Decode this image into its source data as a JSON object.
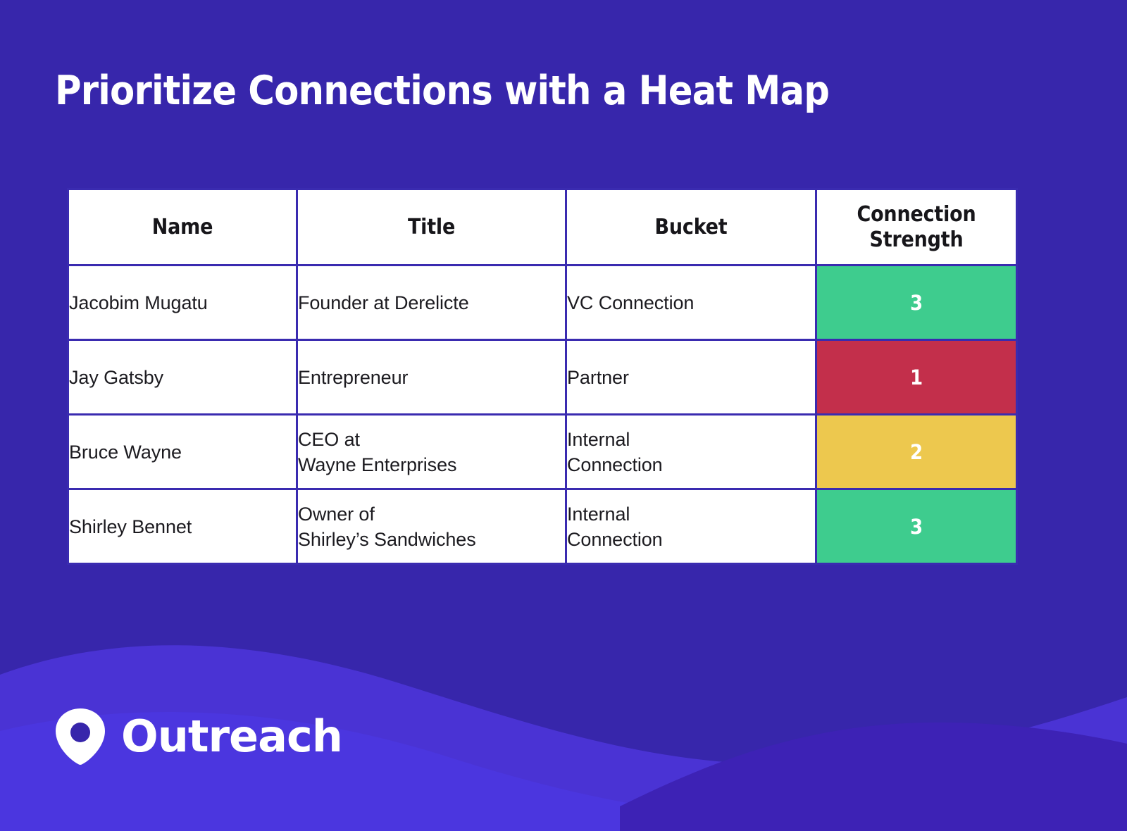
{
  "slide": {
    "title": "Prioritize Connections with a Heat Map",
    "background_color": "#3726ab",
    "wave_colors": [
      "#4a33d4",
      "#4b36df",
      "#3d22b5"
    ]
  },
  "table": {
    "columns": [
      {
        "key": "name",
        "label": "Name"
      },
      {
        "key": "title",
        "label": "Title"
      },
      {
        "key": "bucket",
        "label": "Bucket"
      },
      {
        "key": "strength",
        "label": "Connection\nStrength",
        "label_line1": "Connection",
        "label_line2": "Strength"
      }
    ],
    "border_color": "#3a2bb0",
    "rows": [
      {
        "name": "Jacobim Mugatu",
        "title_line1": "Founder at Derelicte",
        "title_line2": "",
        "bucket_line1": "VC Connection",
        "bucket_line2": "",
        "strength": "3",
        "strength_color": "#3ecc8e"
      },
      {
        "name": "Jay Gatsby",
        "title_line1": "Entrepreneur",
        "title_line2": "",
        "bucket_line1": "Partner",
        "bucket_line2": "",
        "strength": "1",
        "strength_color": "#c32f4b"
      },
      {
        "name": "Bruce Wayne",
        "title_line1": "CEO at",
        "title_line2": "Wayne Enterprises",
        "bucket_line1": "Internal",
        "bucket_line2": "Connection",
        "strength": "2",
        "strength_color": "#edc84e"
      },
      {
        "name": "Shirley Bennet",
        "title_line1": "Owner of",
        "title_line2": "Shirley’s Sandwiches",
        "bucket_line1": "Internal",
        "bucket_line2": "Connection",
        "strength": "3",
        "strength_color": "#3ecc8e"
      }
    ]
  },
  "footer": {
    "logo_icon": "outreach-drop-icon",
    "brand": "Outreach"
  },
  "chart_data": {
    "type": "heatmap",
    "title": "Prioritize Connections with a Heat Map",
    "columns": [
      "Name",
      "Title",
      "Bucket",
      "Connection Strength"
    ],
    "rows": [
      {
        "Name": "Jacobim Mugatu",
        "Title": "Founder at Derelicte",
        "Bucket": "VC Connection",
        "Connection Strength": 3
      },
      {
        "Name": "Jay Gatsby",
        "Title": "Entrepreneur",
        "Bucket": "Partner",
        "Connection Strength": 1
      },
      {
        "Name": "Bruce Wayne",
        "Title": "CEO at Wayne Enterprises",
        "Bucket": "Internal Connection",
        "Connection Strength": 2
      },
      {
        "Name": "Shirley Bennet",
        "Title": "Owner of Shirley’s Sandwiches",
        "Bucket": "Internal Connection",
        "Connection Strength": 3
      }
    ],
    "value_scale": [
      1,
      2,
      3
    ],
    "value_colors": {
      "1": "#c32f4b",
      "2": "#edc84e",
      "3": "#3ecc8e"
    },
    "legend": "none",
    "grid": true
  }
}
